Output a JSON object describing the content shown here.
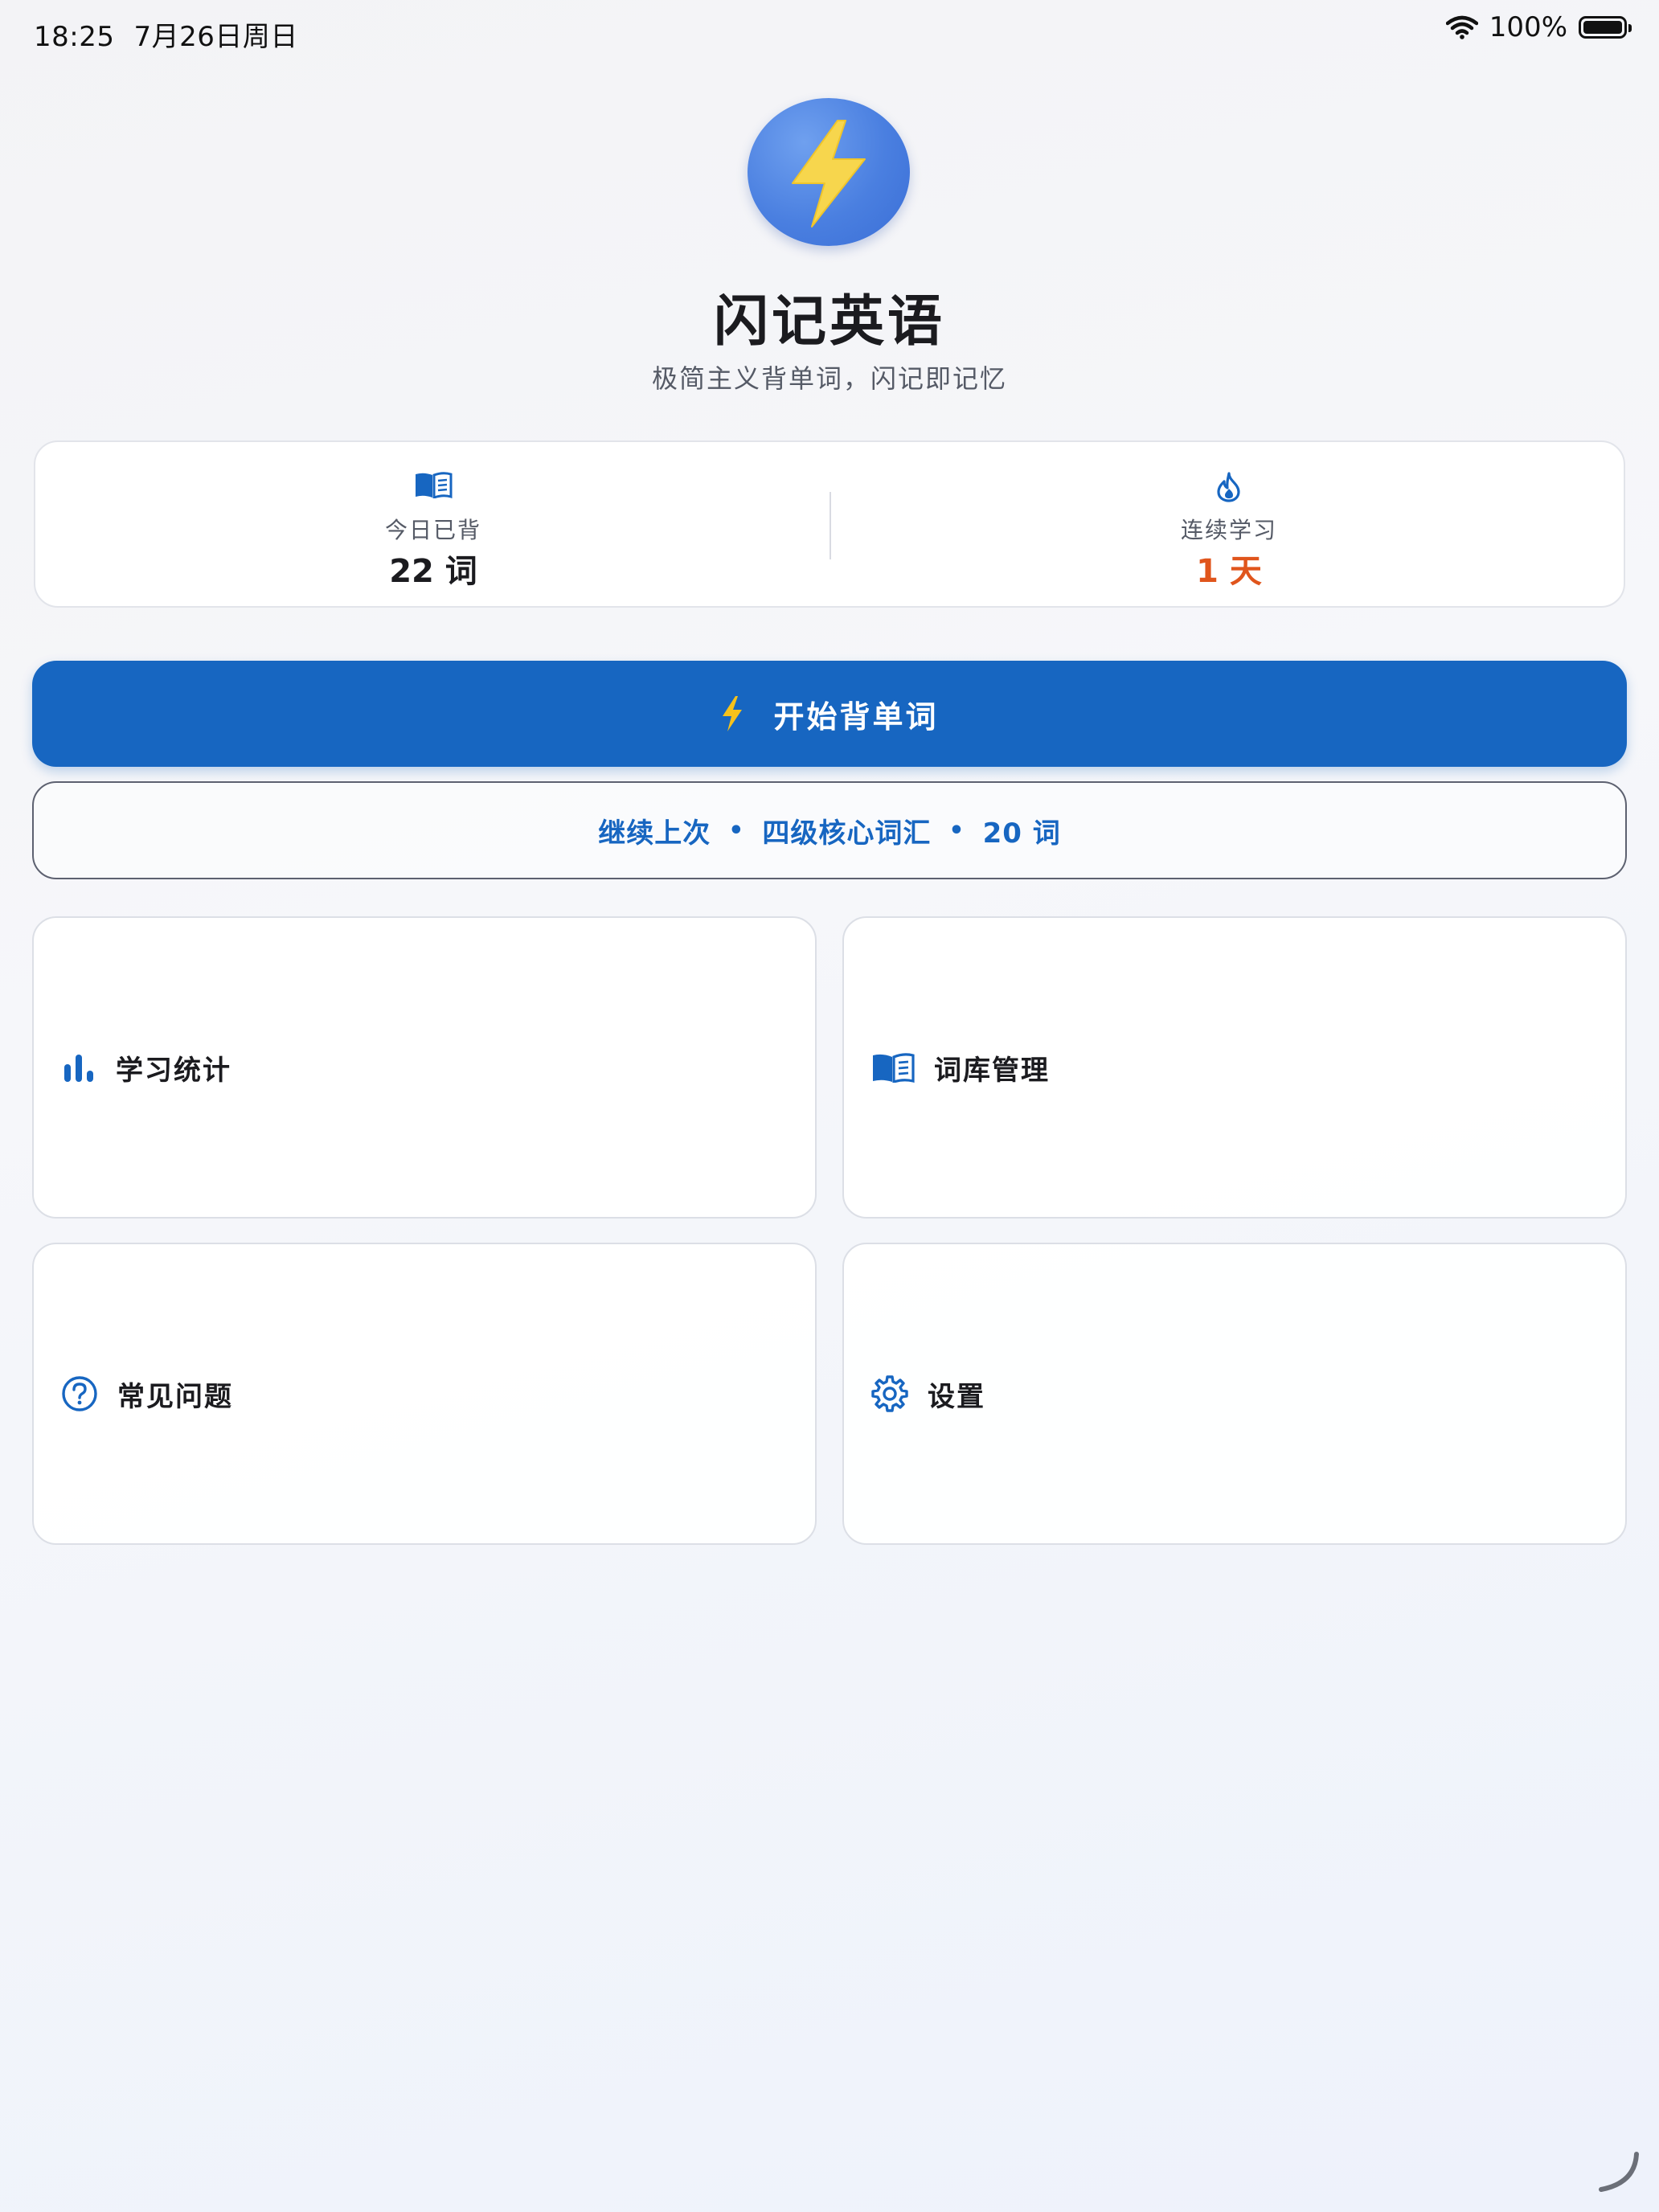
{
  "status_bar": {
    "time": "18:25",
    "date": "7月26日周日",
    "battery": "100%"
  },
  "app": {
    "title": "闪记英语",
    "subtitle": "极简主义背单词，闪记即记忆",
    "logo_icon": "lightning-bolt-icon"
  },
  "stats": {
    "today": {
      "icon": "open-book-icon",
      "label": "今日已背",
      "value": "22 词"
    },
    "streak": {
      "icon": "flame-icon",
      "label": "连续学习",
      "value": "1 天"
    }
  },
  "actions": {
    "start": {
      "icon": "lightning-bolt-icon",
      "label": "开始背单词"
    },
    "continue": {
      "prefix": "继续上次",
      "deck": "四级核心词汇",
      "count": "20 词",
      "separator": "•"
    }
  },
  "tiles": [
    {
      "icon": "bar-chart-icon",
      "label": "学习统计"
    },
    {
      "icon": "open-book-icon",
      "label": "词库管理"
    },
    {
      "icon": "help-circle-icon",
      "label": "常见问题"
    },
    {
      "icon": "gear-icon",
      "label": "设置"
    }
  ],
  "colors": {
    "primary": "#1766c1",
    "accent": "#e0551c",
    "bolt": "#f6c21b"
  }
}
